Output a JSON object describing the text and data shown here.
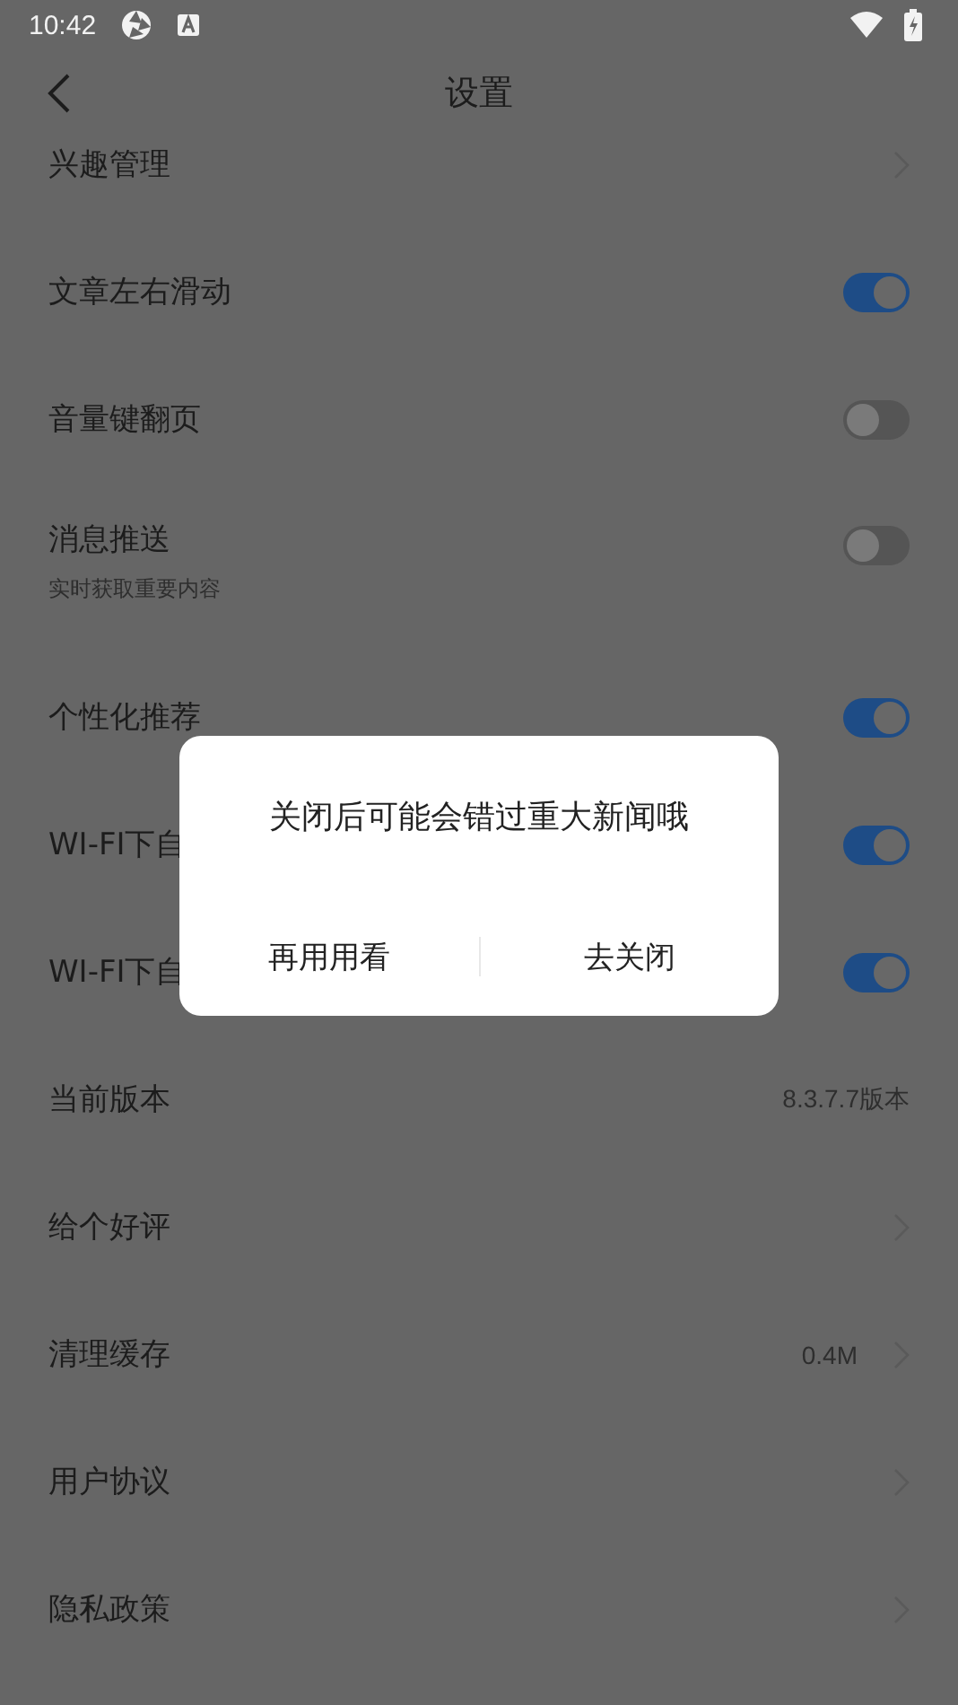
{
  "status_bar": {
    "time": "10:42"
  },
  "header": {
    "title": "设置"
  },
  "settings": [
    {
      "kind": "link",
      "label": "兴趣管理"
    },
    {
      "kind": "toggle",
      "label": "文章左右滑动",
      "on": true
    },
    {
      "kind": "toggle",
      "label": "音量键翻页",
      "on": false
    },
    {
      "kind": "toggle",
      "label": "消息推送",
      "subtitle": "实时获取重要内容",
      "on": false
    },
    {
      "kind": "toggle",
      "label": "个性化推荐",
      "on": true
    },
    {
      "kind": "toggle",
      "label": "WI-FI下自",
      "on": true
    },
    {
      "kind": "toggle",
      "label": "WI-FI下自",
      "on": true
    },
    {
      "kind": "value",
      "label": "当前版本",
      "value": "8.3.7.7版本"
    },
    {
      "kind": "link",
      "label": "给个好评"
    },
    {
      "kind": "link",
      "label": "清理缓存",
      "value": "0.4M"
    },
    {
      "kind": "link",
      "label": "用户协议"
    },
    {
      "kind": "link",
      "label": "隐私政策"
    }
  ],
  "dialog": {
    "message": "关闭后可能会错过重大新闻哦",
    "buttons": [
      "再用用看",
      "去关闭"
    ]
  }
}
